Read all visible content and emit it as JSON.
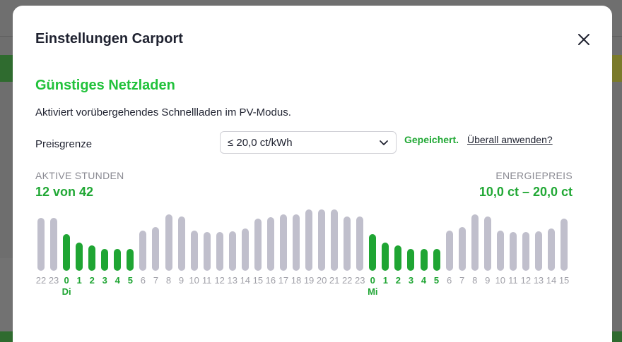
{
  "modal": {
    "title": "Einstellungen Carport",
    "section_title": "Günstiges Netzladen",
    "description": "Aktiviert vorübergehendes Schnellladen im PV-Modus.",
    "price_label": "Preisgrenze",
    "price_value": "≤ 20,0 ct/kWh",
    "saved_text": "Gepeichert.",
    "apply_link": "Überall anwenden?",
    "active_hours_label": "AKTIVE STUNDEN",
    "active_hours_value": "12 von 42",
    "energy_price_label": "ENERGIEPREIS",
    "energy_price_value": "10,0 ct – 20,0 ct"
  },
  "colors": {
    "accent_green": "#21c23b",
    "active_bar": "#1fa533",
    "inactive_bar": "#c0bfcc"
  },
  "chart_data": {
    "type": "bar",
    "categories": [
      "22",
      "23",
      "0",
      "1",
      "2",
      "3",
      "4",
      "5",
      "6",
      "7",
      "8",
      "9",
      "10",
      "11",
      "12",
      "13",
      "14",
      "15",
      "16",
      "17",
      "18",
      "19",
      "20",
      "21",
      "22",
      "23",
      "0",
      "1",
      "2",
      "3",
      "4",
      "5",
      "6",
      "7",
      "8",
      "9",
      "10",
      "11",
      "12",
      "13",
      "14",
      "15"
    ],
    "values": [
      15,
      15,
      10.5,
      8,
      7.3,
      6.2,
      6.2,
      6.2,
      11.5,
      12.4,
      16,
      15.4,
      11.5,
      11,
      11,
      11.2,
      12,
      14.8,
      15.2,
      16,
      16,
      17.4,
      17.4,
      17.4,
      15.4,
      15.4,
      10.5,
      8,
      7.3,
      6.2,
      6.2,
      6.2,
      11.5,
      12.4,
      16,
      15.4,
      11.5,
      11,
      11,
      11.2,
      12,
      14.8
    ],
    "active": [
      false,
      false,
      true,
      true,
      true,
      true,
      true,
      true,
      false,
      false,
      false,
      false,
      false,
      false,
      false,
      false,
      false,
      false,
      false,
      false,
      false,
      false,
      false,
      false,
      false,
      false,
      true,
      true,
      true,
      true,
      true,
      true,
      false,
      false,
      false,
      false,
      false,
      false,
      false,
      false,
      false,
      false
    ],
    "day_labels": [
      {
        "index": 2,
        "label": "Di"
      },
      {
        "index": 26,
        "label": "Mi"
      }
    ],
    "ylim": [
      0,
      18
    ]
  }
}
